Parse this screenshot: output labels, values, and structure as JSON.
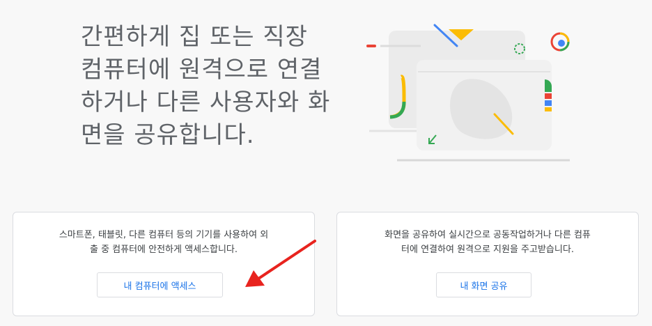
{
  "hero": {
    "line1": "간편하게 집 또는 직장",
    "line2": "컴퓨터에 원격으로 연결",
    "line3": "하거나 다른 사용자와 화",
    "line4": "면을 공유합니다."
  },
  "cards": {
    "access": {
      "line1": "스마트폰, 태블릿, 다른 컴퓨터 등의 기기를 사용하여 외",
      "line2": "출 중 컴퓨터에 안전하게 액세스합니다.",
      "button": "내 컴퓨터에 액세스"
    },
    "share": {
      "line1": "화면을 공유하여 실시간으로 공동작업하거나 다른 컴퓨",
      "line2": "터에 연결하여 원격으로 지원을 주고받습니다.",
      "button": "내 화면 공유"
    }
  },
  "colors": {
    "accent": "#1a73e8",
    "annotation_arrow": "#e8231e",
    "google_red": "#ea4335",
    "google_yellow": "#fbbc04",
    "google_green": "#34a853",
    "google_blue": "#4285f4"
  }
}
